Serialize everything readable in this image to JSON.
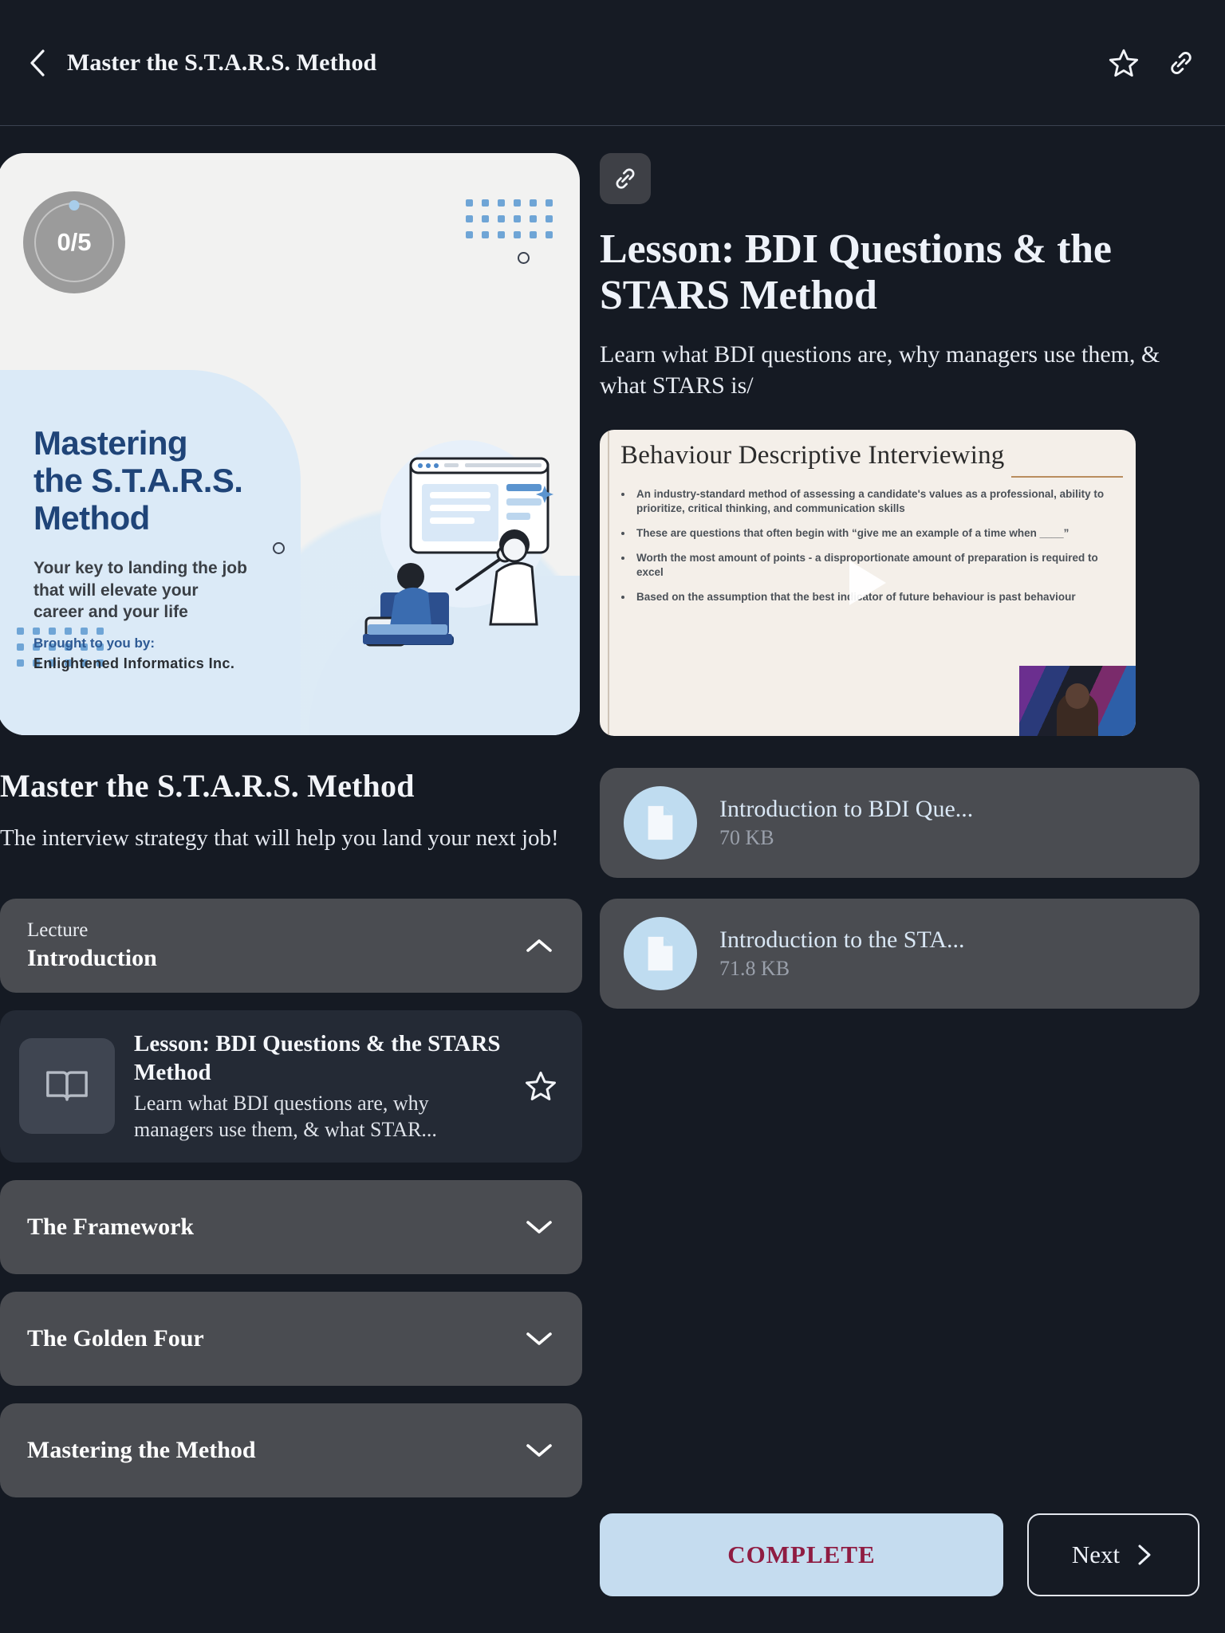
{
  "header": {
    "back_icon": "chevron-left-icon",
    "title": "Master the S.T.A.R.S. Method",
    "star_icon": "star-icon",
    "link_icon": "link-icon"
  },
  "course_card": {
    "progress_value": "0/5",
    "heading": "Mastering\nthe S.T.A.R.S.\nMethod",
    "heading_line1": "Mastering",
    "heading_line2": "the S.T.A.R.S.",
    "heading_line3": "Method",
    "subtitle_line1": "Your key to landing the job",
    "subtitle_line2": "that will elevate your",
    "subtitle_line3": "career and your life",
    "brought_by_label": "Brought to you by:",
    "brought_by_name": "Enlightened Informatics Inc.",
    "heading_color": "#1f4478",
    "card_bg": "#f2f2f1",
    "accent_blue": "#dbeaf7"
  },
  "course": {
    "title": "Master the S.T.A.R.S. Method",
    "description": "The interview strategy that will help you land your next job!"
  },
  "sections": [
    {
      "kicker": "Lecture",
      "name": "Introduction",
      "expanded": true,
      "chevron": "chevron-up-icon",
      "lessons": [
        {
          "icon": "book-icon",
          "title": "Lesson: BDI Questions & the STARS Method",
          "description": "Learn what BDI questions are, why managers use them, & what STAR...",
          "star_icon": "star-icon"
        }
      ]
    },
    {
      "name": "The Framework",
      "expanded": false,
      "chevron": "chevron-down-icon",
      "lessons": []
    },
    {
      "name": "The Golden Four",
      "expanded": false,
      "chevron": "chevron-down-icon",
      "lessons": []
    },
    {
      "name": "Mastering the Method",
      "expanded": false,
      "chevron": "chevron-down-icon",
      "lessons": []
    }
  ],
  "lesson_panel": {
    "link_icon": "link-icon",
    "title": "Lesson: BDI Questions & the STARS Method",
    "subtitle": "Learn what BDI questions are, why managers use them, & what STARS is/",
    "video": {
      "slide_title": "Behaviour Descriptive Interviewing",
      "play_icon": "play-icon",
      "bullets": [
        "An industry-standard method of assessing a candidate's values as a professional, ability to prioritize, critical thinking, and communication skills",
        "These are questions that often begin with “give me an example of a time when ____”",
        "Worth the most amount of points - a disproportionate amount of preparation is required to excel",
        "Based on the assumption that the best indicator of future behaviour is past behaviour"
      ]
    },
    "attachments": [
      {
        "icon": "document-icon",
        "name": "Introduction to BDI Que...",
        "size": "70 KB"
      },
      {
        "icon": "document-icon",
        "name": "Introduction to the STA...",
        "size": "71.8 KB"
      }
    ],
    "complete_label": "COMPLETE",
    "next_label": "Next",
    "next_icon": "chevron-right-icon",
    "complete_bg": "#c5dcef",
    "complete_text_color": "#8f1c42"
  }
}
